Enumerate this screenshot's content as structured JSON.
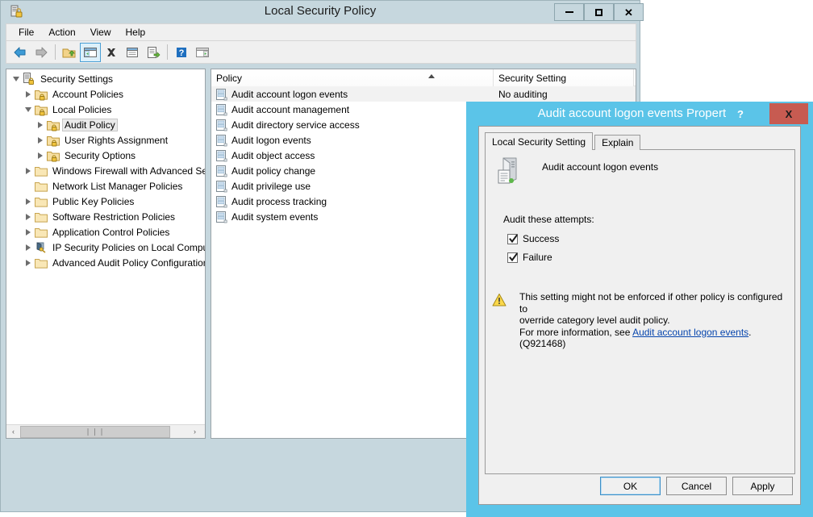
{
  "main_window": {
    "title": "Local Security Policy",
    "title_icon": "security-policy-icon",
    "window_controls": {
      "minimize": "─",
      "maximize": "□",
      "close": "✕"
    },
    "menu": [
      {
        "label": "File"
      },
      {
        "label": "Action"
      },
      {
        "label": "View"
      },
      {
        "label": "Help"
      }
    ],
    "toolbar": [
      {
        "name": "back-icon"
      },
      {
        "name": "forward-icon"
      },
      {
        "name": "up-folder-icon"
      },
      {
        "name": "show-hide-tree-icon",
        "pressed": true
      },
      {
        "name": "delete-icon"
      },
      {
        "name": "properties-icon"
      },
      {
        "name": "export-list-icon"
      },
      {
        "name": "help-icon"
      },
      {
        "name": "show-pane-icon"
      }
    ]
  },
  "tree": {
    "items": [
      {
        "label": "Security Settings",
        "indent": 0,
        "expander": "expanded",
        "icon": "security-settings-icon",
        "selected": false
      },
      {
        "label": "Account Policies",
        "indent": 1,
        "expander": "collapsed",
        "icon": "policy-folder-icon",
        "selected": false
      },
      {
        "label": "Local Policies",
        "indent": 1,
        "expander": "expanded",
        "icon": "policy-folder-icon",
        "selected": false
      },
      {
        "label": "Audit Policy",
        "indent": 2,
        "expander": "collapsed",
        "icon": "policy-folder-icon",
        "selected": true
      },
      {
        "label": "User Rights Assignment",
        "indent": 2,
        "expander": "collapsed",
        "icon": "policy-folder-icon",
        "selected": false
      },
      {
        "label": "Security Options",
        "indent": 2,
        "expander": "collapsed",
        "icon": "policy-folder-icon",
        "selected": false
      },
      {
        "label": "Windows Firewall with Advanced Secu",
        "indent": 1,
        "expander": "collapsed",
        "icon": "folder-icon",
        "selected": false
      },
      {
        "label": "Network List Manager Policies",
        "indent": 1,
        "expander": "none",
        "icon": "folder-icon",
        "selected": false
      },
      {
        "label": "Public Key Policies",
        "indent": 1,
        "expander": "collapsed",
        "icon": "folder-icon",
        "selected": false
      },
      {
        "label": "Software Restriction Policies",
        "indent": 1,
        "expander": "collapsed",
        "icon": "folder-icon",
        "selected": false
      },
      {
        "label": "Application Control Policies",
        "indent": 1,
        "expander": "collapsed",
        "icon": "folder-icon",
        "selected": false
      },
      {
        "label": "IP Security Policies on Local Compute",
        "indent": 1,
        "expander": "collapsed",
        "icon": "ipsec-icon",
        "selected": false
      },
      {
        "label": "Advanced Audit Policy Configuration",
        "indent": 1,
        "expander": "collapsed",
        "icon": "folder-icon",
        "selected": false
      }
    ],
    "hscroll": {
      "left_arrow": "‹",
      "right_arrow": "›",
      "thumb_grip": "❘❘❘"
    }
  },
  "list": {
    "columns": [
      {
        "label": "Policy",
        "sorted": "asc"
      },
      {
        "label": "Security Setting",
        "sorted": "none"
      }
    ],
    "rows": [
      {
        "policy": "Audit account logon events",
        "setting": "No auditing",
        "selected": true
      },
      {
        "policy": "Audit account management",
        "setting": "",
        "selected": false
      },
      {
        "policy": "Audit directory service access",
        "setting": "",
        "selected": false
      },
      {
        "policy": "Audit logon events",
        "setting": "",
        "selected": false
      },
      {
        "policy": "Audit object access",
        "setting": "",
        "selected": false
      },
      {
        "policy": "Audit policy change",
        "setting": "",
        "selected": false
      },
      {
        "policy": "Audit privilege use",
        "setting": "",
        "selected": false
      },
      {
        "policy": "Audit process tracking",
        "setting": "",
        "selected": false
      },
      {
        "policy": "Audit system events",
        "setting": "",
        "selected": false
      }
    ]
  },
  "dialog": {
    "title": "Audit account logon events Properties",
    "help_button": "?",
    "close_button": "X",
    "tabs": [
      {
        "label": "Local Security Setting",
        "active": true
      },
      {
        "label": "Explain",
        "active": false
      }
    ],
    "policy_name": "Audit account logon events",
    "audit_label": "Audit these attempts:",
    "checkboxes": [
      {
        "label": "Success",
        "checked": true
      },
      {
        "label": "Failure",
        "checked": true
      }
    ],
    "warning": {
      "line1": "This setting might not be enforced if other policy is configured to",
      "line2": "override category level audit policy.",
      "line3_prefix": "For more information, see ",
      "link": "Audit account logon events",
      "line3_suffix": ". (Q921468)"
    },
    "buttons": [
      {
        "label": "OK",
        "default": true
      },
      {
        "label": "Cancel",
        "default": false
      },
      {
        "label": "Apply",
        "default": false
      }
    ],
    "accent_color": "#5bc4e8",
    "close_color": "#c75b51"
  }
}
